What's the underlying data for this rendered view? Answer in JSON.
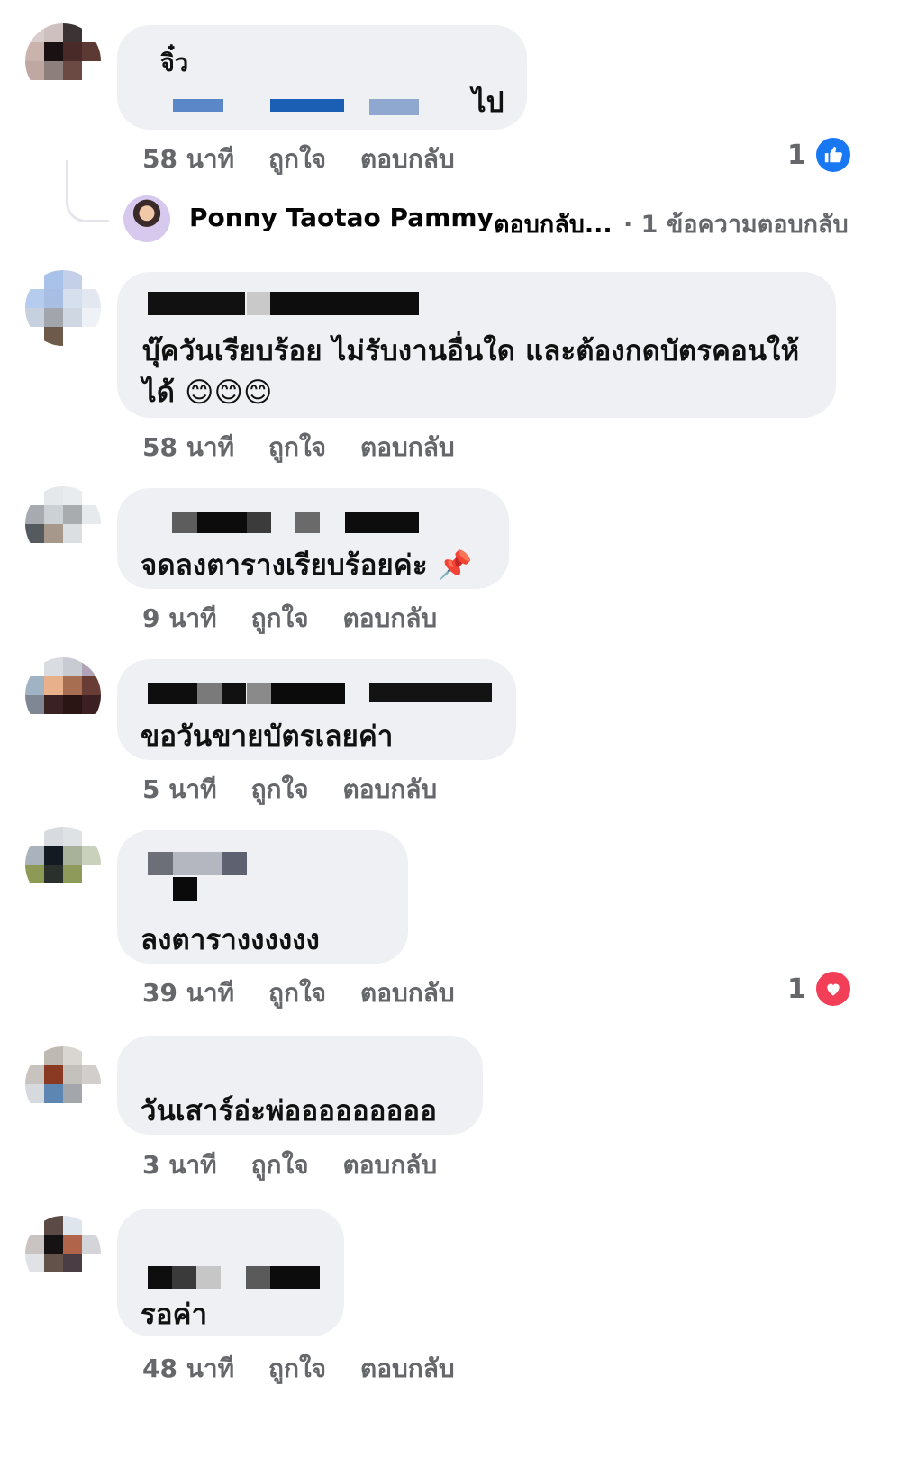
{
  "reply_thread": {
    "name": "Ponny Taotao Pammy",
    "action": "ตอบกลับ...",
    "count": "· 1 ข้อความตอบกลับ"
  },
  "actions": {
    "like": "ถูกใจ",
    "reply": "ตอบกลับ"
  },
  "comments": [
    {
      "text": "ไป",
      "name_fragment": "จิ๋ว",
      "time": "58 นาที",
      "reaction": {
        "count": "1",
        "type": "like-icon"
      }
    },
    {
      "text_line1": "บุ๊ควันเรียบร้อย ไม่รับงานอื่นใด และต้องกดบัตรคอนให้",
      "text_line2": "ได้ 😊😊😊",
      "time": "58 นาที"
    },
    {
      "text": "จดลงตารางเรียบร้อยค่ะ 📌",
      "time": "9 นาที"
    },
    {
      "text": "ขอวันขายบัตรเลยค่า",
      "time": "5 นาที"
    },
    {
      "text": "ลงตารางงงงงง",
      "time": "39 นาที",
      "reaction": {
        "count": "1",
        "type": "love-icon"
      }
    },
    {
      "text": "วันเสาร์อ่ะพ่อออออออออ",
      "time": "3 นาที"
    },
    {
      "text": "รอค่า",
      "time": "48 นาที"
    }
  ],
  "colors": {
    "bubble": "#eef0f3",
    "meta": "#65676b",
    "like": "#1877f2",
    "love": "#f33e58"
  }
}
